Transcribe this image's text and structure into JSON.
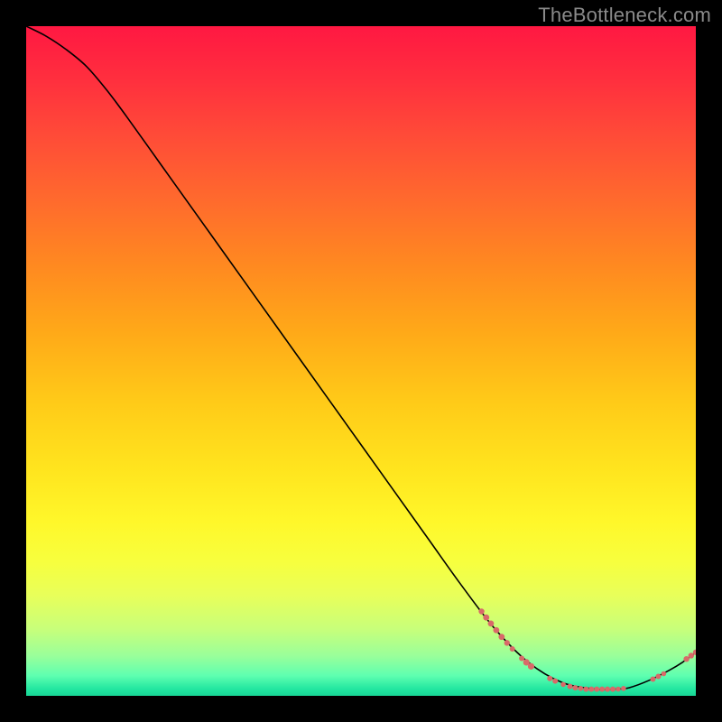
{
  "watermark": "TheBottleneck.com",
  "chart_data": {
    "type": "line",
    "title": "",
    "xlabel": "",
    "ylabel": "",
    "xlim": [
      0,
      100
    ],
    "ylim": [
      0,
      100
    ],
    "grid": false,
    "legend": false,
    "curve_color": "#000000",
    "point_color": "#d86a69",
    "curve": [
      {
        "x": 0.0,
        "y": 100.0
      },
      {
        "x": 3.0,
        "y": 98.5
      },
      {
        "x": 6.0,
        "y": 96.5
      },
      {
        "x": 9.0,
        "y": 94.0
      },
      {
        "x": 12.0,
        "y": 90.5
      },
      {
        "x": 15.0,
        "y": 86.5
      },
      {
        "x": 20.0,
        "y": 79.5
      },
      {
        "x": 25.0,
        "y": 72.5
      },
      {
        "x": 30.0,
        "y": 65.5
      },
      {
        "x": 35.0,
        "y": 58.5
      },
      {
        "x": 40.0,
        "y": 51.5
      },
      {
        "x": 45.0,
        "y": 44.5
      },
      {
        "x": 50.0,
        "y": 37.5
      },
      {
        "x": 55.0,
        "y": 30.5
      },
      {
        "x": 60.0,
        "y": 23.5
      },
      {
        "x": 65.0,
        "y": 16.5
      },
      {
        "x": 70.0,
        "y": 10.0
      },
      {
        "x": 75.0,
        "y": 5.0
      },
      {
        "x": 80.0,
        "y": 2.0
      },
      {
        "x": 85.0,
        "y": 1.0
      },
      {
        "x": 88.0,
        "y": 1.0
      },
      {
        "x": 90.0,
        "y": 1.2
      },
      {
        "x": 93.0,
        "y": 2.3
      },
      {
        "x": 96.0,
        "y": 3.8
      },
      {
        "x": 98.0,
        "y": 5.0
      },
      {
        "x": 100.0,
        "y": 6.5
      }
    ],
    "points": [
      {
        "x": 68.0,
        "y": 12.6,
        "r": 3.2
      },
      {
        "x": 68.7,
        "y": 11.7,
        "r": 3.4
      },
      {
        "x": 69.4,
        "y": 10.8,
        "r": 3.4
      },
      {
        "x": 70.2,
        "y": 9.8,
        "r": 3.4
      },
      {
        "x": 71.0,
        "y": 8.8,
        "r": 3.4
      },
      {
        "x": 71.8,
        "y": 7.9,
        "r": 3.2
      },
      {
        "x": 72.6,
        "y": 7.0,
        "r": 3.0
      },
      {
        "x": 74.0,
        "y": 5.6,
        "r": 3.0
      },
      {
        "x": 74.7,
        "y": 5.0,
        "r": 3.6
      },
      {
        "x": 75.4,
        "y": 4.4,
        "r": 3.6
      },
      {
        "x": 78.2,
        "y": 2.6,
        "r": 3.0
      },
      {
        "x": 79.0,
        "y": 2.2,
        "r": 3.0
      },
      {
        "x": 80.2,
        "y": 1.7,
        "r": 2.8
      },
      {
        "x": 81.2,
        "y": 1.4,
        "r": 3.0
      },
      {
        "x": 82.0,
        "y": 1.2,
        "r": 3.0
      },
      {
        "x": 82.8,
        "y": 1.1,
        "r": 2.8
      },
      {
        "x": 83.6,
        "y": 1.0,
        "r": 3.0
      },
      {
        "x": 84.4,
        "y": 1.0,
        "r": 3.0
      },
      {
        "x": 85.2,
        "y": 1.0,
        "r": 3.0
      },
      {
        "x": 86.0,
        "y": 1.0,
        "r": 3.0
      },
      {
        "x": 86.8,
        "y": 1.0,
        "r": 3.0
      },
      {
        "x": 87.6,
        "y": 1.0,
        "r": 3.0
      },
      {
        "x": 88.4,
        "y": 1.0,
        "r": 2.8
      },
      {
        "x": 89.2,
        "y": 1.1,
        "r": 2.8
      },
      {
        "x": 93.6,
        "y": 2.5,
        "r": 3.0
      },
      {
        "x": 94.4,
        "y": 2.9,
        "r": 3.0
      },
      {
        "x": 95.2,
        "y": 3.3,
        "r": 2.8
      },
      {
        "x": 98.6,
        "y": 5.5,
        "r": 3.2
      },
      {
        "x": 99.3,
        "y": 6.0,
        "r": 3.2
      },
      {
        "x": 100.0,
        "y": 6.5,
        "r": 3.2
      }
    ]
  }
}
